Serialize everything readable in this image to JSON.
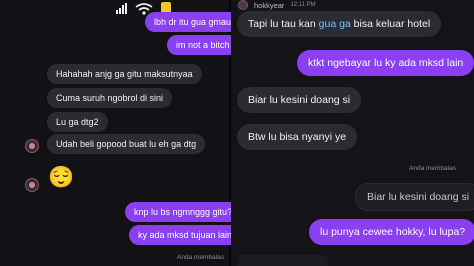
{
  "left": {
    "messages_out_top": [
      "lbh dr itu gua gmau",
      "im not a bitch"
    ],
    "messages_in": [
      "Hahahah anjg ga gitu maksutnyaa",
      "Cuma suruh ngobrol di sini",
      "Lu ga dtg2",
      "Udah beli gopood buat lu eh ga dtg"
    ],
    "emoji": "😌",
    "messages_out_bottom": [
      "knp lu bs ngmnggg gitu?",
      "ky ada mksd tujuan lain"
    ],
    "reply_label": "Anda membalas"
  },
  "right": {
    "header": {
      "username": "hokkyear",
      "time": "12:11 PM"
    },
    "msg1_pre": "Tapi lu tau kan ",
    "msg1_hl": "gua ga",
    "msg1_post": " bisa keluar hotel",
    "msg2": "ktkt ngebayar lu ky ada mksd lain",
    "msg3": "Biar lu kesini doang si",
    "msg4": "Btw lu bisa nyanyi ye",
    "reply_label": "Anda membalas",
    "quoted": "Biar lu kesini doang si",
    "msg5": "lu punya cewee hokky, lu lupa?"
  },
  "colors": {
    "outgoing": "#8a3ff0",
    "incoming": "#2b2c31",
    "highlight": "#6ec4ff",
    "battery": "#f4c430"
  }
}
